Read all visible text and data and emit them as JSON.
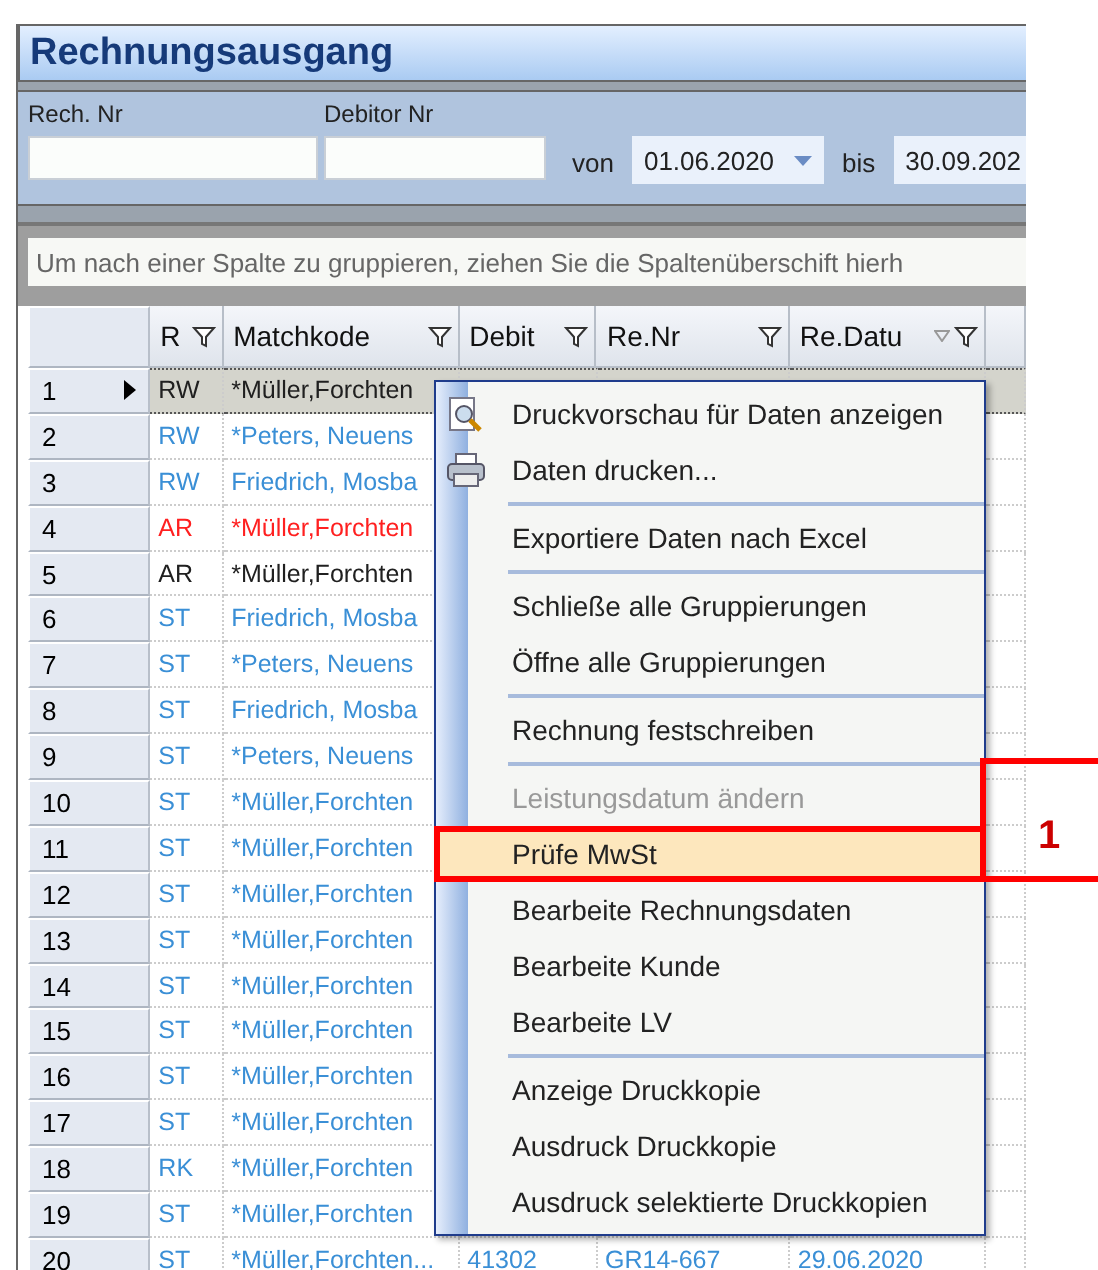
{
  "window": {
    "title": "Rechnungsausgang"
  },
  "filters": {
    "rech_nr": {
      "label": "Rech. Nr"
    },
    "debitor_nr": {
      "label": "Debitor Nr"
    },
    "von": {
      "label": "von",
      "value": "01.06.2020"
    },
    "bis": {
      "label": "bis",
      "value": "30.09.202"
    }
  },
  "group_panel": {
    "hint": "Um nach einer Spalte zu gruppieren, ziehen Sie die Spaltenüberschift hierh"
  },
  "table": {
    "columns": [
      {
        "label": "R",
        "sorted": false
      },
      {
        "label": "Matchkode",
        "sorted": false
      },
      {
        "label": "Debit",
        "sorted": false
      },
      {
        "label": "Re.Nr",
        "sorted": false
      },
      {
        "label": "Re.Datu",
        "sorted": true
      }
    ],
    "rows": [
      {
        "number": "1",
        "selected": true,
        "color": "#202020",
        "cells": [
          "RW",
          "*Müller,Forchten"
        ]
      },
      {
        "number": "2",
        "selected": false,
        "color": "#3a8fd6",
        "cells": [
          "RW",
          "*Peters,  Neuens"
        ]
      },
      {
        "number": "3",
        "selected": false,
        "color": "#3a8fd6",
        "cells": [
          "RW",
          "Friedrich, Mosba"
        ]
      },
      {
        "number": "4",
        "selected": false,
        "color": "#ff2020",
        "cells": [
          "AR",
          "*Müller,Forchten"
        ]
      },
      {
        "number": "5",
        "selected": false,
        "color": "#202020",
        "cells": [
          "AR",
          "*Müller,Forchten"
        ]
      },
      {
        "number": "6",
        "selected": false,
        "color": "#3a8fd6",
        "cells": [
          "ST",
          "Friedrich, Mosba"
        ]
      },
      {
        "number": "7",
        "selected": false,
        "color": "#3a8fd6",
        "cells": [
          "ST",
          "*Peters,  Neuens"
        ]
      },
      {
        "number": "8",
        "selected": false,
        "color": "#3a8fd6",
        "cells": [
          "ST",
          "Friedrich, Mosba"
        ]
      },
      {
        "number": "9",
        "selected": false,
        "color": "#3a8fd6",
        "cells": [
          "ST",
          "*Peters,  Neuens"
        ]
      },
      {
        "number": "10",
        "selected": false,
        "color": "#3a8fd6",
        "cells": [
          "ST",
          "*Müller,Forchten"
        ]
      },
      {
        "number": "11",
        "selected": false,
        "color": "#3a8fd6",
        "cells": [
          "ST",
          "*Müller,Forchten"
        ]
      },
      {
        "number": "12",
        "selected": false,
        "color": "#3a8fd6",
        "cells": [
          "ST",
          "*Müller,Forchten"
        ]
      },
      {
        "number": "13",
        "selected": false,
        "color": "#3a8fd6",
        "cells": [
          "ST",
          "*Müller,Forchten"
        ]
      },
      {
        "number": "14",
        "selected": false,
        "color": "#3a8fd6",
        "cells": [
          "ST",
          "*Müller,Forchten"
        ]
      },
      {
        "number": "15",
        "selected": false,
        "color": "#3a8fd6",
        "cells": [
          "ST",
          "*Müller,Forchten"
        ]
      },
      {
        "number": "16",
        "selected": false,
        "color": "#3a8fd6",
        "cells": [
          "ST",
          "*Müller,Forchten"
        ]
      },
      {
        "number": "17",
        "selected": false,
        "color": "#3a8fd6",
        "cells": [
          "ST",
          "*Müller,Forchten"
        ]
      },
      {
        "number": "18",
        "selected": false,
        "color": "#3a8fd6",
        "cells": [
          "RK",
          "*Müller,Forchten"
        ]
      },
      {
        "number": "19",
        "selected": false,
        "color": "#3a8fd6",
        "cells": [
          "ST",
          "*Müller,Forchten"
        ]
      },
      {
        "number": "20",
        "selected": false,
        "color": "#3a8fd6",
        "cells": [
          "ST",
          "*Müller,Forchten...",
          "41302",
          "GR14-667",
          "29.06.2020"
        ]
      }
    ]
  },
  "context_menu": {
    "items": [
      {
        "kind": "preview",
        "label": "Druckvorschau für Daten anzeigen",
        "disabled": false,
        "selected": false
      },
      {
        "kind": "print",
        "label": "Daten drucken...",
        "disabled": false,
        "selected": false
      },
      {
        "kind": "separator"
      },
      {
        "kind": "plain",
        "label": "Exportiere Daten nach Excel",
        "disabled": false,
        "selected": false
      },
      {
        "kind": "separator"
      },
      {
        "kind": "plain",
        "label": "Schließe alle Gruppierungen",
        "disabled": false,
        "selected": false
      },
      {
        "kind": "plain",
        "label": "Öffne alle Gruppierungen",
        "disabled": false,
        "selected": false
      },
      {
        "kind": "separator"
      },
      {
        "kind": "plain",
        "label": "Rechnung festschreiben",
        "disabled": false,
        "selected": false
      },
      {
        "kind": "separator"
      },
      {
        "kind": "plain",
        "label": "Leistungsdatum ändern",
        "disabled": true,
        "selected": false
      },
      {
        "kind": "plain",
        "label": "Prüfe MwSt",
        "disabled": false,
        "selected": true
      },
      {
        "kind": "plain",
        "label": "Bearbeite Rechnungsdaten",
        "disabled": false,
        "selected": false
      },
      {
        "kind": "plain",
        "label": "Bearbeite Kunde",
        "disabled": false,
        "selected": false
      },
      {
        "kind": "plain",
        "label": "Bearbeite LV",
        "disabled": false,
        "selected": false
      },
      {
        "kind": "separator"
      },
      {
        "kind": "plain",
        "label": "Anzeige Druckkopie",
        "disabled": false,
        "selected": false
      },
      {
        "kind": "plain",
        "label": "Ausdruck Druckkopie",
        "disabled": false,
        "selected": false
      },
      {
        "kind": "plain",
        "label": "Ausdruck selektierte Druckkopien",
        "disabled": false,
        "selected": false
      }
    ]
  },
  "callout": {
    "label": "1"
  }
}
